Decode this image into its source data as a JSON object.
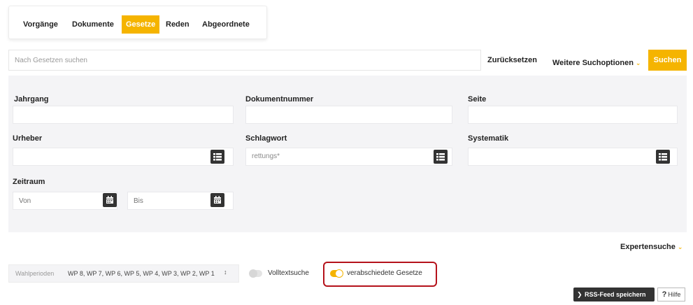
{
  "tabs": [
    {
      "label": "Vorgänge",
      "active": false
    },
    {
      "label": "Dokumente",
      "active": false
    },
    {
      "label": "Gesetze",
      "active": true
    },
    {
      "label": "Reden",
      "active": false
    },
    {
      "label": "Abgeordnete",
      "active": false
    }
  ],
  "search": {
    "placeholder": "Nach Gesetzen suchen",
    "reset_label": "Zurücksetzen",
    "more_options_label": "Weitere Suchoptionen",
    "submit_label": "Suchen"
  },
  "form": {
    "jahrgang": {
      "label": "Jahrgang",
      "value": ""
    },
    "dokumentnummer": {
      "label": "Dokumentnummer",
      "value": ""
    },
    "seite": {
      "label": "Seite",
      "value": ""
    },
    "urheber": {
      "label": "Urheber",
      "value": ""
    },
    "schlagwort": {
      "label": "Schlagwort",
      "value": "rettungs*"
    },
    "systematik": {
      "label": "Systematik",
      "value": ""
    },
    "zeitraum": {
      "label": "Zeitraum",
      "from_placeholder": "Von",
      "to_placeholder": "Bis"
    }
  },
  "expert_search_label": "Expertensuche",
  "filters": {
    "wahlperioden_label": "Wahlperioden",
    "wahlperioden_value": "WP 8, WP 7, WP 6, WP 5, WP 4, WP 3, WP 2, WP 1",
    "volltextsuche": {
      "label": "Volltextsuche",
      "on": false
    },
    "verabschiedete": {
      "label": "verabschiedete Gesetze",
      "on": true
    }
  },
  "footer": {
    "rss_label": "RSS-Feed speichern",
    "help_label": "Hilfe",
    "help_icon": "?"
  },
  "colors": {
    "accent": "#f5b400",
    "highlight": "#b5121b",
    "dark_button": "#333333"
  }
}
